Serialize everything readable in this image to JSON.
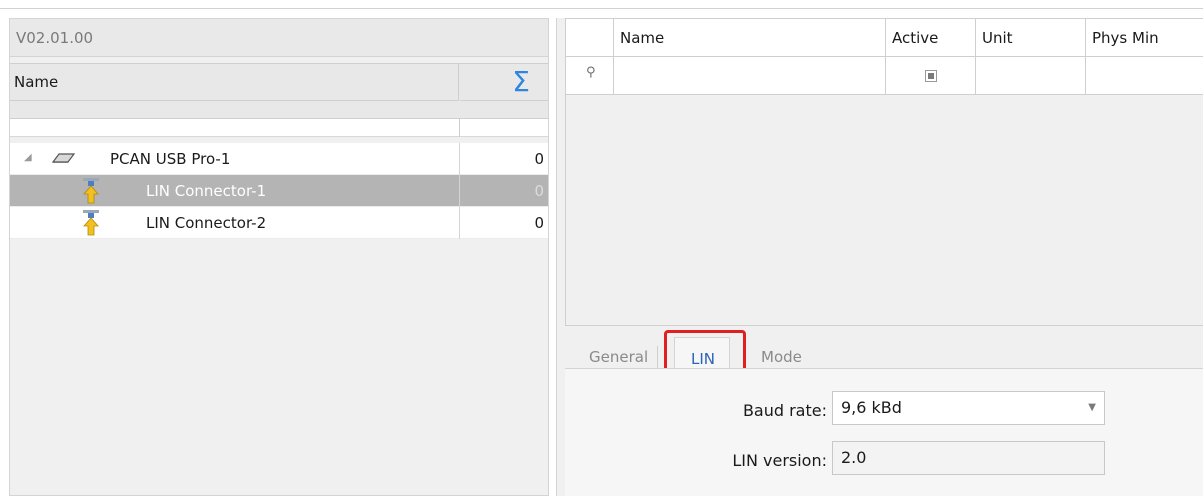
{
  "left": {
    "version": "V02.01.00",
    "col_name": "Name",
    "col_sum_icon": "sigma-icon",
    "tree": [
      {
        "label": "PCAN USB Pro-1",
        "count": "0",
        "icon": "usb-device-icon",
        "expanded": true
      },
      {
        "label": "LIN Connector-1",
        "count": "0",
        "icon": "lin-connector-icon",
        "selected": true
      },
      {
        "label": "LIN Connector-2",
        "count": "0",
        "icon": "lin-connector-icon"
      }
    ]
  },
  "right": {
    "columns": [
      "Name",
      "Active",
      "Unit",
      "Phys Min"
    ],
    "filter_icon": "pin-icon",
    "tabs": {
      "general": "General",
      "lin": "LIN",
      "mode": "Mode",
      "active": "LIN"
    },
    "props": {
      "baud_label": "Baud rate:",
      "baud_value": "9,6 kBd",
      "version_label": "LIN version:",
      "version_value": "2.0"
    }
  },
  "colors": {
    "accent_blue": "#2b63b8",
    "highlight_red": "#e02020",
    "selected_row": "#b4b4b4"
  }
}
